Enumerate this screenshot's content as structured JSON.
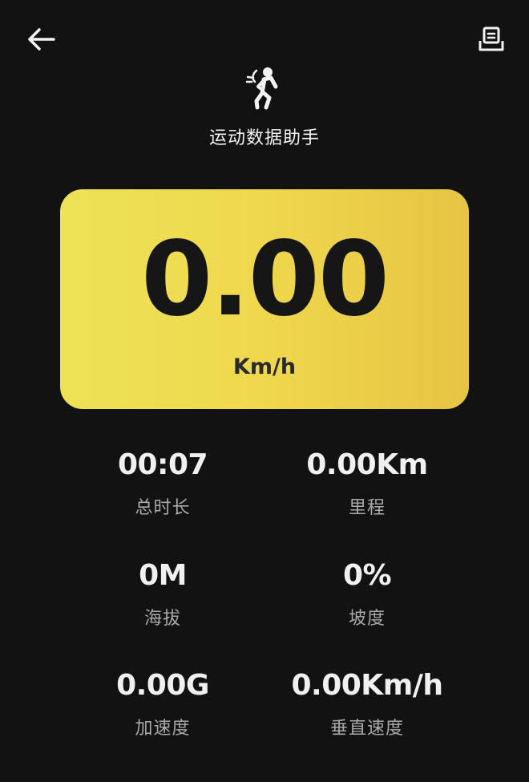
{
  "header": {
    "title": "运动数据助手",
    "back_icon": "arrow-left-icon",
    "export_icon": "export-tray-icon",
    "logo_icon": "runner-icon"
  },
  "speed": {
    "value": "0.00",
    "unit": "Km/h"
  },
  "stats": [
    {
      "value": "00:07",
      "label": "总时长"
    },
    {
      "value": "0.00Km",
      "label": "里程"
    },
    {
      "value": "0M",
      "label": "海拔"
    },
    {
      "value": "0%",
      "label": "坡度"
    },
    {
      "value": "0.00G",
      "label": "加速度"
    },
    {
      "value": "0.00Km/h",
      "label": "垂直速度"
    }
  ],
  "colors": {
    "background": "#121212",
    "card_gradient_start": "#ede257",
    "card_gradient_end": "#e8c444",
    "primary_text": "#f0f0f0",
    "secondary_text": "#a9a9a9"
  }
}
